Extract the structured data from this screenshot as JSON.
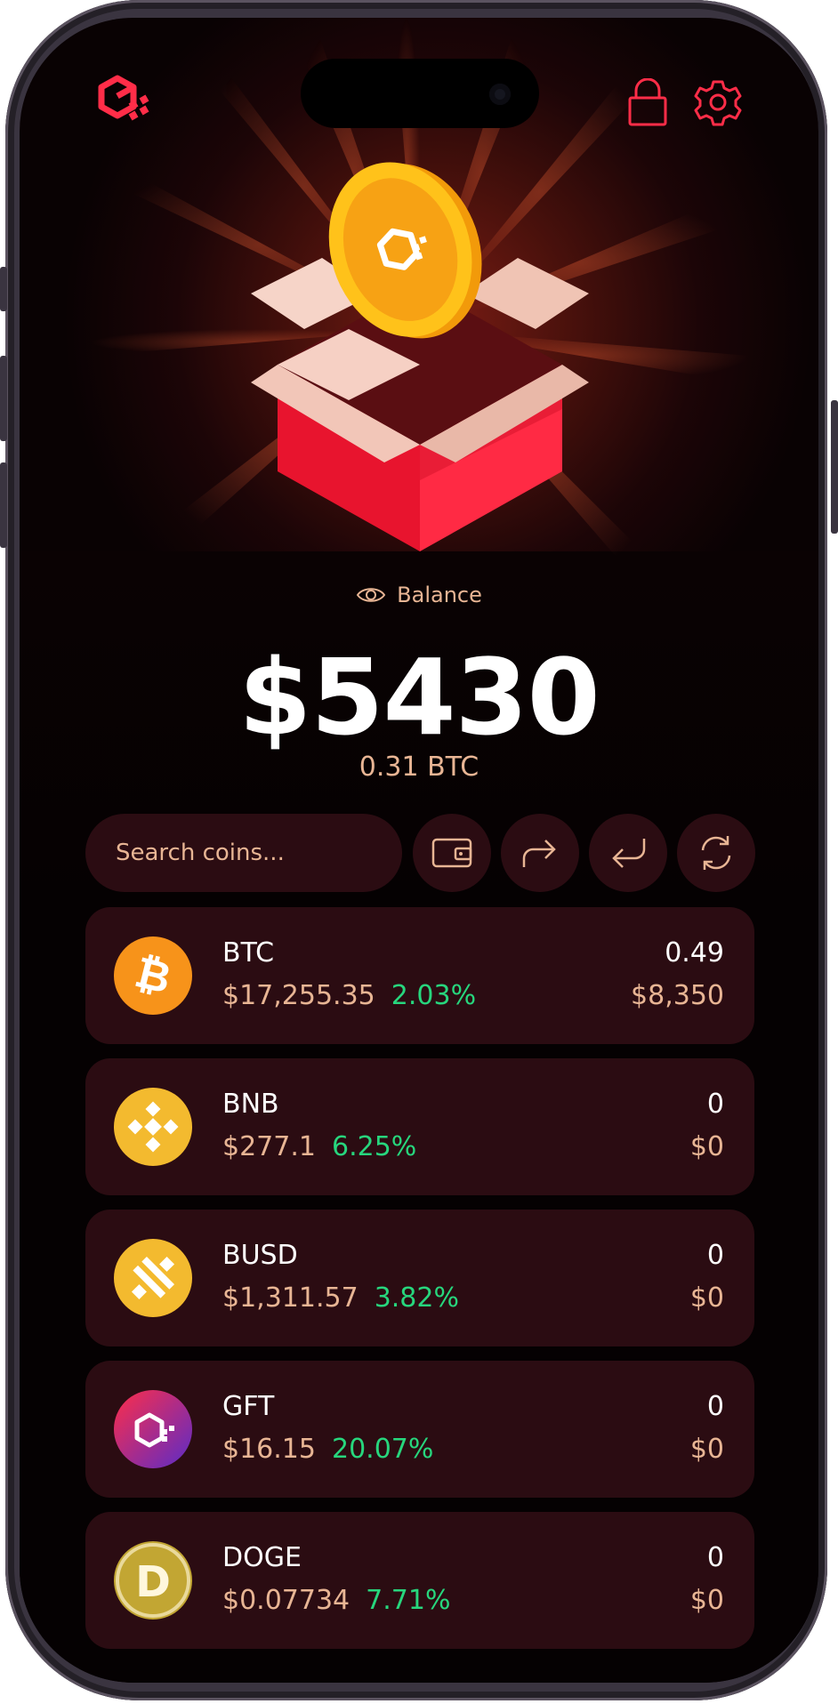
{
  "app": {
    "logo": "gift-wallet-logo",
    "accent": "#ff2d48"
  },
  "header": {
    "lock_icon": "lock-icon",
    "settings_icon": "gear-icon"
  },
  "balance": {
    "label": "Balance",
    "amount": "$5430",
    "btc": "0.31 BTC"
  },
  "search": {
    "placeholder": "Search coins..."
  },
  "actions": [
    {
      "icon": "wallet-icon"
    },
    {
      "icon": "send-icon"
    },
    {
      "icon": "receive-icon"
    },
    {
      "icon": "swap-icon"
    }
  ],
  "coins": [
    {
      "symbol": "BTC",
      "price": "$17,255.35",
      "change": "2.03%",
      "amount": "0.49",
      "value": "$8,350",
      "color": "#f7931a"
    },
    {
      "symbol": "BNB",
      "price": "$277.1",
      "change": "6.25%",
      "amount": "0",
      "value": "$0",
      "color": "#f3ba2f"
    },
    {
      "symbol": "BUSD",
      "price": "$1,311.57",
      "change": "3.82%",
      "amount": "0",
      "value": "$0",
      "color": "#f3ba2f"
    },
    {
      "symbol": "GFT",
      "price": "$16.15",
      "change": "20.07%",
      "amount": "0",
      "value": "$0",
      "color": "#d61f6a"
    },
    {
      "symbol": "DOGE",
      "price": "$0.07734",
      "change": "7.71%",
      "amount": "0",
      "value": "$0",
      "color": "#c2a633"
    }
  ],
  "colors": {
    "positive": "#27d67d",
    "muted": "#e8b594",
    "card": "#2b0c12"
  }
}
